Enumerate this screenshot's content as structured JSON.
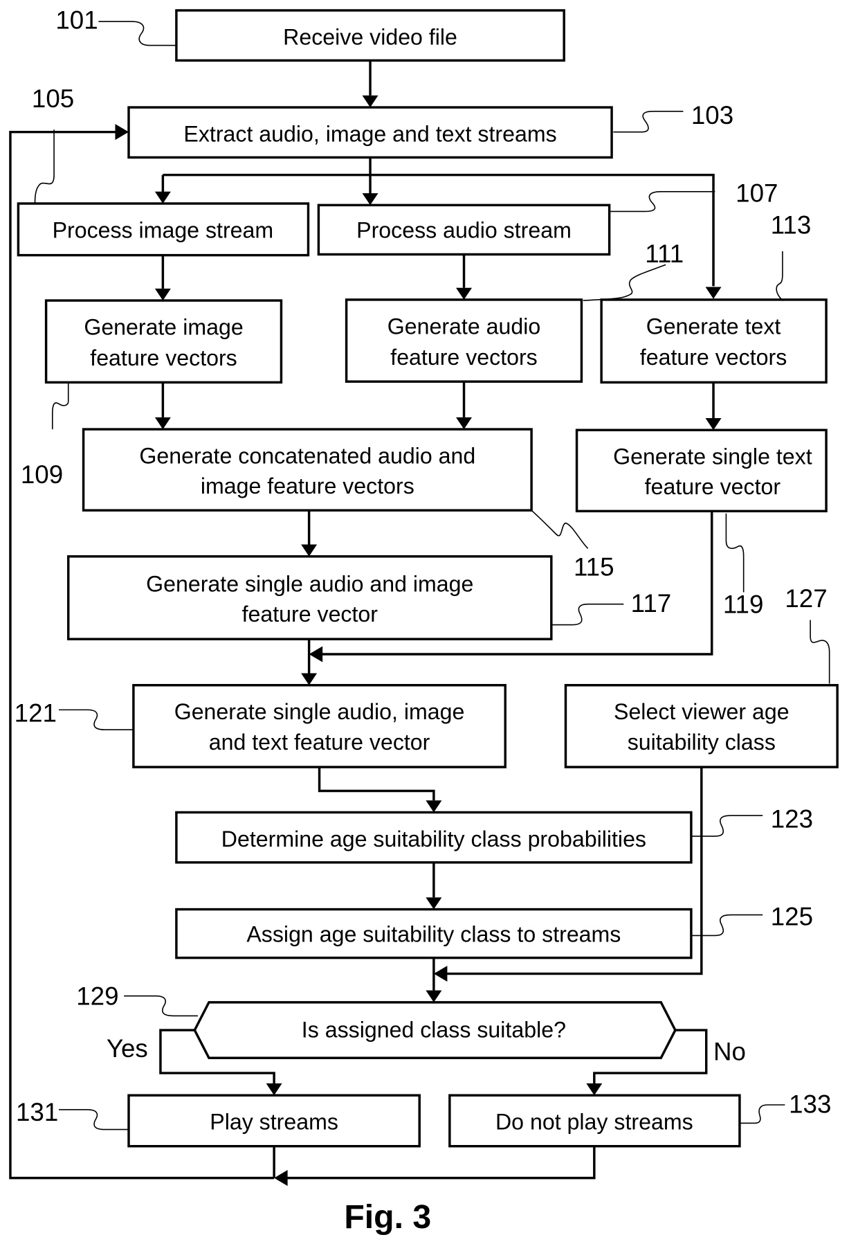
{
  "figure": {
    "caption": "Fig. 3"
  },
  "steps": {
    "s101": {
      "ref": "101",
      "lines": [
        "Receive video file"
      ]
    },
    "s103": {
      "ref": "103",
      "lines": [
        "Extract audio, image and text streams"
      ]
    },
    "s105": {
      "ref": "105",
      "lines": [
        "Process image stream"
      ]
    },
    "s107": {
      "ref": "107",
      "lines": [
        "Process audio stream"
      ]
    },
    "s109": {
      "ref": "109",
      "lines": [
        "Generate image",
        "feature vectors"
      ]
    },
    "s111": {
      "ref": "111",
      "lines": [
        "Generate audio",
        "feature vectors"
      ]
    },
    "s113": {
      "ref": "113",
      "lines": [
        "Generate text",
        "feature vectors"
      ]
    },
    "s115": {
      "ref": "115",
      "lines": [
        "Generate concatenated audio and",
        "image feature vectors"
      ]
    },
    "s119": {
      "ref": "119",
      "lines": [
        "Generate single text",
        "feature vector"
      ]
    },
    "s117": {
      "ref": "117",
      "lines": [
        "Generate single audio and image",
        "feature vector"
      ]
    },
    "s121": {
      "ref": "121",
      "lines": [
        "Generate single audio, image",
        "and text feature vector"
      ]
    },
    "s127": {
      "ref": "127",
      "lines": [
        "Select viewer age",
        "suitability class"
      ]
    },
    "s123": {
      "ref": "123",
      "lines": [
        "Determine age suitability class probabilities"
      ]
    },
    "s125": {
      "ref": "125",
      "lines": [
        "Assign age suitability class to streams"
      ]
    },
    "s129": {
      "ref": "129",
      "lines": [
        "Is assigned class suitable?"
      ]
    },
    "s131": {
      "ref": "131",
      "lines": [
        "Play streams"
      ]
    },
    "s133": {
      "ref": "133",
      "lines": [
        "Do not play streams"
      ]
    }
  },
  "branches": {
    "yes": "Yes",
    "no": "No"
  }
}
